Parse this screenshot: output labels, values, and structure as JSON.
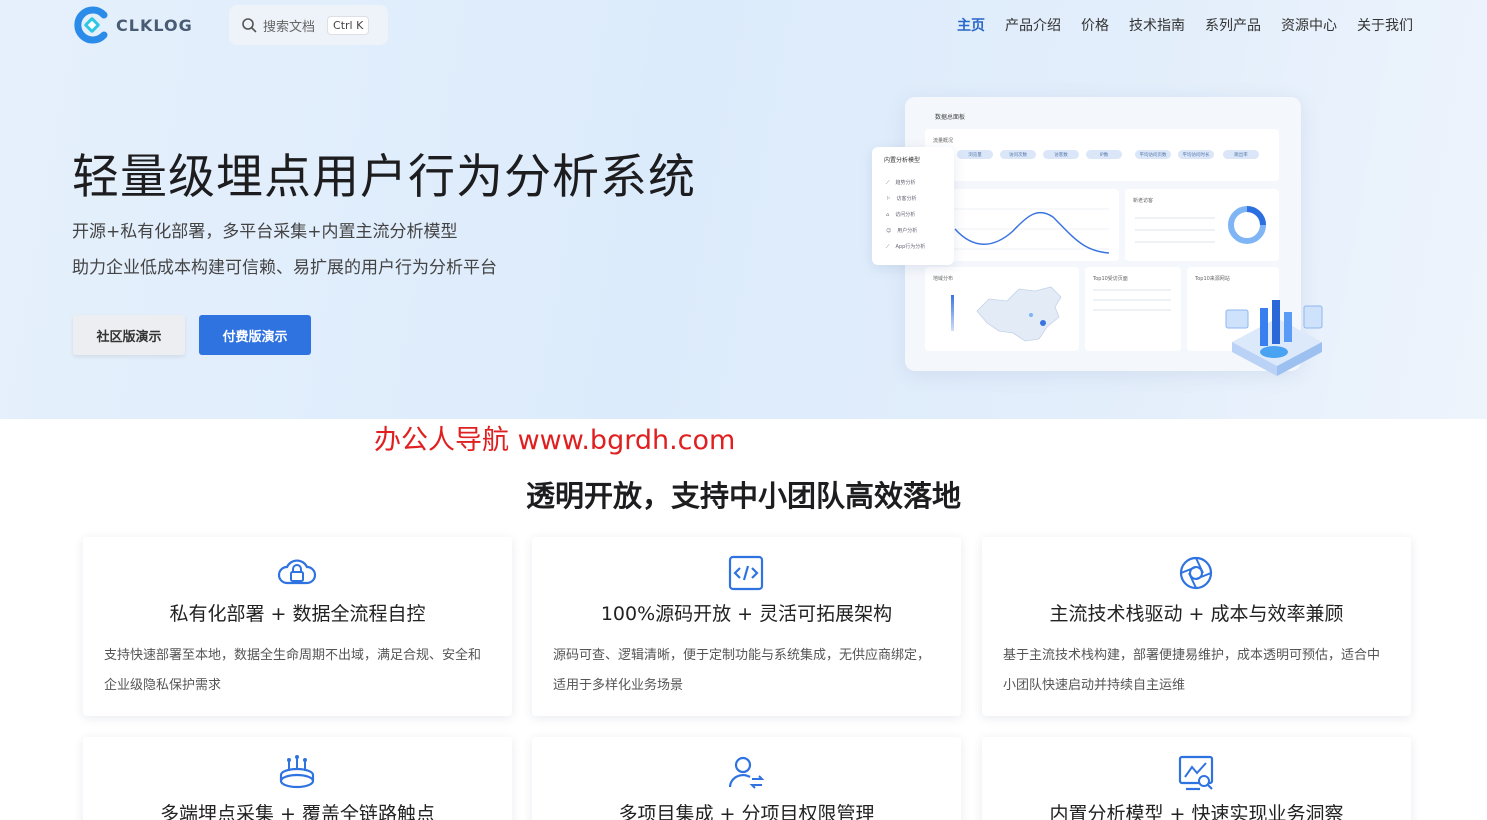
{
  "header": {
    "logo_text": "CLKLOG",
    "search_placeholder": "搜索文档",
    "search_shortcut": "Ctrl K",
    "nav": [
      "主页",
      "产品介绍",
      "价格",
      "技术指南",
      "系列产品",
      "资源中心",
      "关于我们"
    ],
    "active_nav": "主页"
  },
  "hero": {
    "title": "轻量级埋点用户行为分析系统",
    "subtitle1": "开源+私有化部署，多平台采集+内置主流分析模型",
    "subtitle2": "助力企业低成本构建可信赖、易扩展的用户行为分析平台",
    "btn_community": "社区版演示",
    "btn_paid": "付费版演示"
  },
  "dashboard": {
    "title": "数据总面板",
    "overview": "流量概况",
    "pills": [
      "浏览量",
      "访问次数",
      "访客数",
      "IP数",
      "平均访问页数",
      "平均访问时长",
      "跳出率"
    ],
    "side_title": "内置分析模型",
    "side_items": [
      "趋势分析",
      "访客分析",
      "访问分析",
      "用户分析",
      "App行为分析"
    ],
    "new_old": "新老访客",
    "region": "地域分布",
    "top_pages": "Top10受访页面",
    "top_sources": "Top10来源网站"
  },
  "watermark": "办公人导航 www.bgrdh.com",
  "section": {
    "title": "透明开放，支持中小团队高效落地",
    "cards": [
      {
        "icon": "cloud-lock-icon",
        "title": "私有化部署 + 数据全流程自控",
        "desc": "支持快速部署至本地，数据全生命周期不出域，满足合规、安全和企业级隐私保护需求"
      },
      {
        "icon": "code-icon",
        "title": "100%源码开放 + 灵活可拓展架构",
        "desc": "源码可查、逻辑清晰，便于定制功能与系统集成，无供应商绑定，适用于多样化业务场景"
      },
      {
        "icon": "aperture-icon",
        "title": "主流技术栈驱动 + 成本与效率兼顾",
        "desc": "基于主流技术栈构建，部署便捷易维护，成本透明可预估，适合中小团队快速启动并持续自主运维"
      },
      {
        "icon": "multi-endpoint-icon",
        "title": "多端埋点采集 + 覆盖全链路触点",
        "desc": ""
      },
      {
        "icon": "user-switch-icon",
        "title": "多项目集成 + 分项目权限管理",
        "desc": ""
      },
      {
        "icon": "chart-search-icon",
        "title": "内置分析模型 + 快速实现业务洞察",
        "desc": ""
      }
    ]
  },
  "colors": {
    "accent": "#2f73e0",
    "nav_active": "#2a67c8",
    "watermark": "#e02020"
  }
}
